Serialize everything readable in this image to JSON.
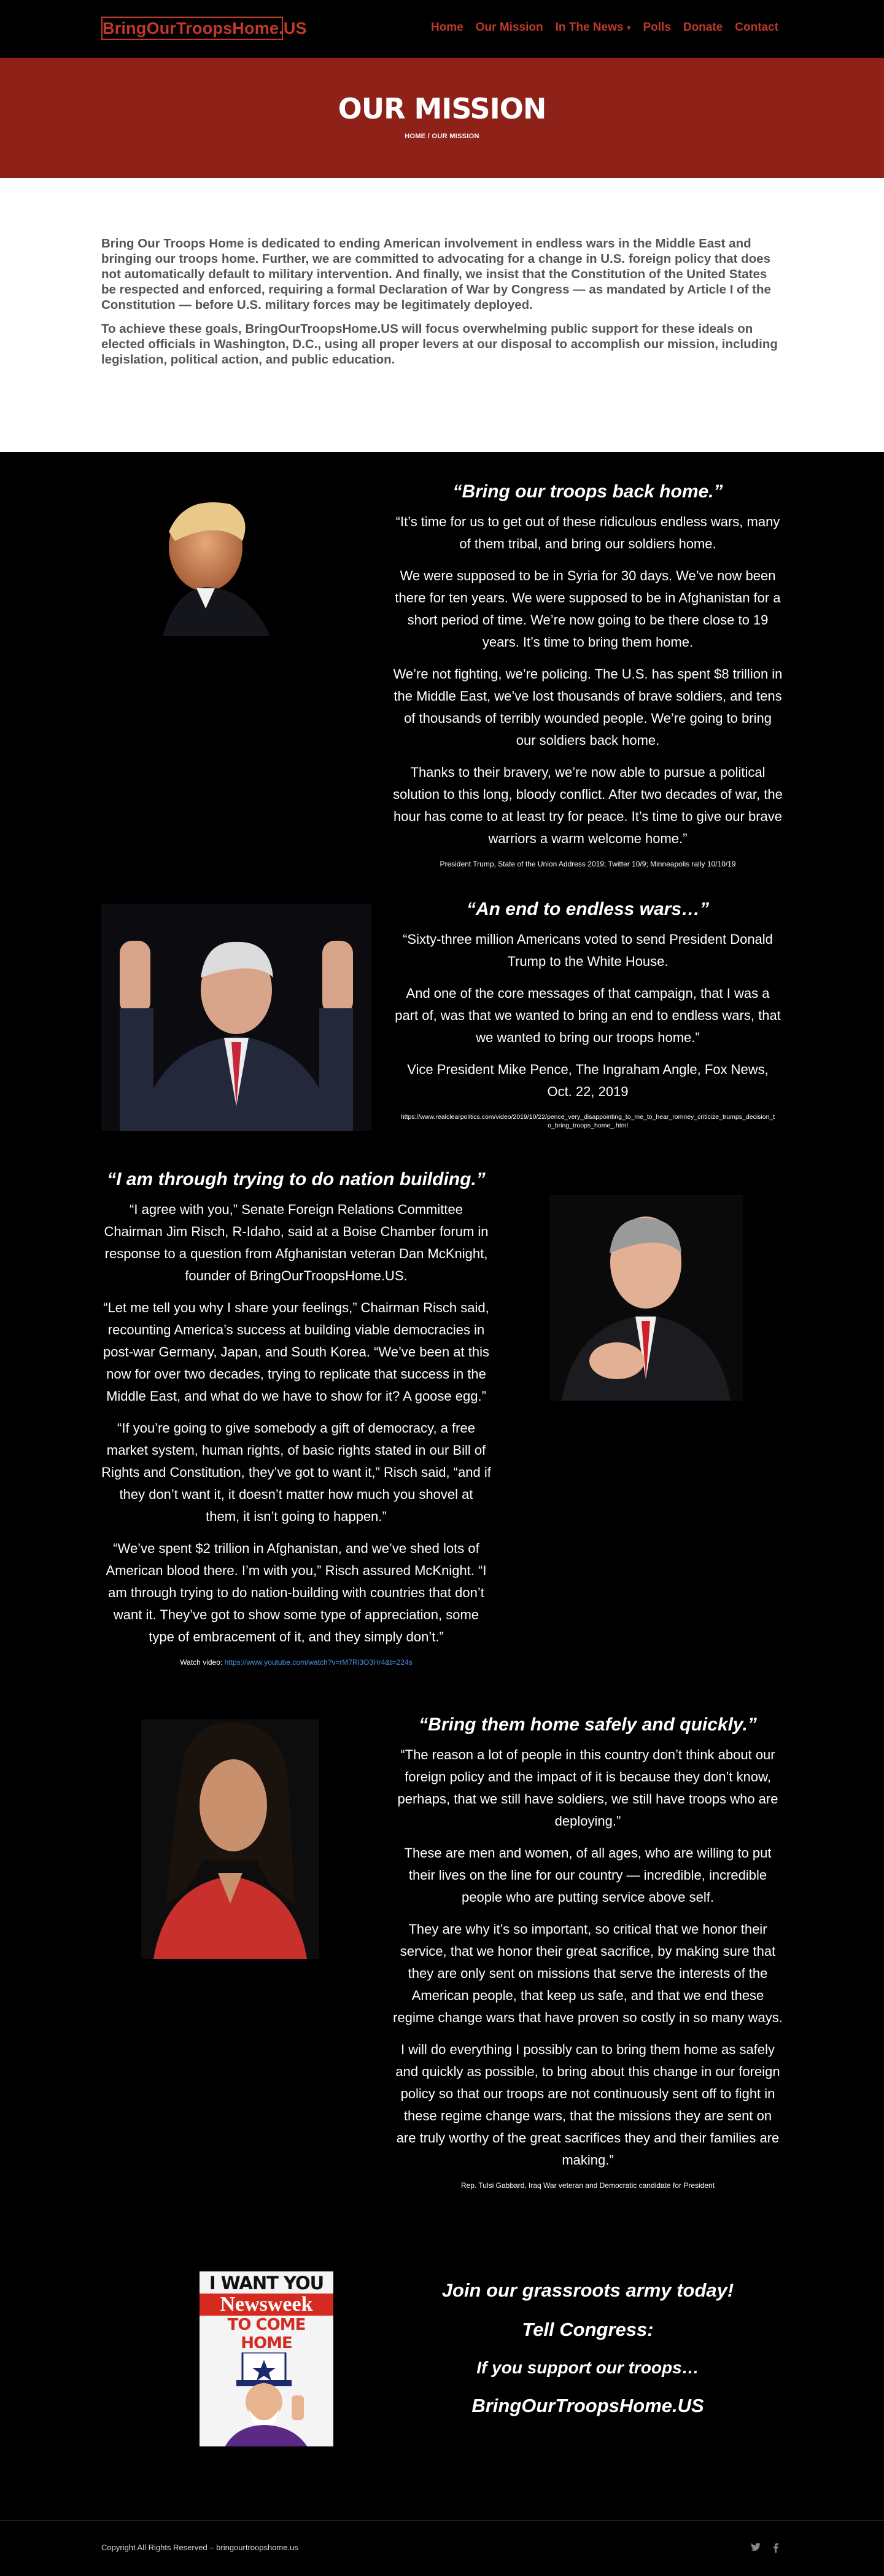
{
  "header": {
    "logo": "BringOurTroopsHome.US",
    "nav": [
      {
        "label": "Home"
      },
      {
        "label": "Our Mission"
      },
      {
        "label": "In The News"
      },
      {
        "label": "Polls"
      },
      {
        "label": "Donate"
      },
      {
        "label": "Contact"
      }
    ]
  },
  "hero": {
    "title": "OUR MISSION",
    "breadcrumb": "HOME / OUR MISSION"
  },
  "intro": {
    "p1": "Bring Our Troops Home is dedicated to ending American involvement in endless wars in the Middle East and bringing our troops home. Further, we are committed to advocating for a change in U.S. foreign policy that does not automatically default to military intervention. And finally, we insist that the Constitution of the United States be respected and enforced, requiring a formal Declaration of War by Congress — as mandated by Article I of the Constitution — before U.S. military forces may be legitimately deployed.",
    "p2": "To achieve these goals, BringOurTroopsHome.US will focus overwhelming public support for these ideals on elected officials in Washington, D.C., using all proper levers at our disposal to accomplish our mission, including legislation, political action, and public education."
  },
  "trump": {
    "headline": "“Bring our troops back home.”",
    "p": [
      "“It’s time for us to get out of these ridiculous endless wars, many of them tribal, and bring our soldiers home.",
      "We were supposed to be in Syria for 30 days. We’ve now been there for ten years. We were supposed to be in Afghanistan for a short period of time. We’re now going to be there close to 19 years. It’s time to bring them home.",
      "We’re not fighting, we’re policing. The U.S. has spent $8 trillion in the Middle East, we’ve lost thousands of brave soldiers, and tens of thousands of terribly wounded people. We’re going to bring our soldiers back home.",
      "Thanks to their bravery, we’re now able to pursue a political solution to this long, bloody conflict. After two decades of war, the hour has come to at least try for peace. It’s time to give our brave warriors a warm welcome home.”"
    ],
    "cite": "President Trump, State of the Union Address 2019; Twitter 10/9; Minneapolis rally 10/10/19"
  },
  "pence": {
    "headline": "“An end to endless wars…”",
    "p": [
      "“Sixty-three million Americans voted to send President Donald Trump to the White House.",
      "And one of the core messages of that campaign, that I was a part of, was that we wanted to bring an end to endless wars, that we wanted to bring our troops home.”",
      "Vice President Mike Pence, The Ingraham Angle, Fox News, Oct. 22, 2019"
    ],
    "cite": "https://www.realclearpolitics.com/video/2019/10/22/pence_very_disappointing_to_me_to_hear_romney_criticize_trumps_decision_to_bring_troops_home_.html"
  },
  "risch": {
    "headline": "“I am through trying to do nation building.”",
    "p": [
      "“I agree with you,” Senate Foreign Relations Committee Chairman Jim Risch, R-Idaho, said at a Boise Chamber forum in response to a question from Afghanistan veteran Dan McKnight, founder of BringOurTroopsHome.US.",
      "“Let me tell you why I share your feelings,” Chairman Risch said, recounting America’s success at building viable democracies in post-war Germany, Japan, and South Korea. “We’ve been at this now for over two decades, trying to replicate that success in the Middle East, and what do we have to show for it? A goose egg.”",
      "“If you’re going to give somebody a gift of democracy, a free market system, human rights, of basic rights stated in our Bill of Rights and Constitution, they’ve got to want it,” Risch said, “and if they don’t want it, it doesn’t matter how much you shovel at them, it isn’t going to happen.”",
      "“We’ve spent $2 trillion in Afghanistan, and we’ve shed lots of American blood there. I’m with you,” Risch assured McKnight. “I am through trying to do nation-building with countries that don’t want it. They’ve got to show some type of appreciation, some type of embracement of it, and they simply don’t.”"
    ],
    "watch_label": "Watch video: ",
    "watch_link": "https://www.youtube.com/watch?v=rM7Rl3O3Hr4&t=224s"
  },
  "gabbard": {
    "headline": "“Bring them home safely and quickly.”",
    "p": [
      "“The reason a lot of people in this country don’t think about our foreign policy and the impact of it is because they don’t know, perhaps, that we still have soldiers, we still have troops who are deploying.”",
      "These are men and women, of all ages, who are willing to put their lives on the line for our country — incredible, incredible people who are putting service above self.",
      "They are why it’s so important, so critical that we honor their service, that we honor their great sacrifice, by making sure that they are only sent on missions that serve the interests of the American people, that keep us safe, and that we end these regime change wars that have proven so costly in so many ways.",
      "I will do everything I possibly can to bring them home as safely and quickly as possible, to bring about this change in our foreign policy so that our troops are not continuously sent off to fight in these regime change wars, that the missions they are sent on are truly worthy of the great sacrifices they and their families are making.”"
    ],
    "cite": "Rep. Tulsi Gabbard, Iraq War veteran and Democratic candidate for President"
  },
  "poster": {
    "line1": "I WANT YOU",
    "brand": "Newsweek",
    "line2": "TO COME HOME"
  },
  "cta": {
    "l1": "Join our grassroots army today!",
    "l2": "Tell Congress:",
    "l3": "If you support our troops…",
    "l4": "BringOurTroopsHome.US"
  },
  "footer": {
    "copyright": "Copyright All Rights Reserved – bringourtroopshome.us"
  },
  "colors": {
    "brand_red": "#c0392b",
    "hero_red": "#8e2118",
    "link_blue": "#4a90e2"
  }
}
